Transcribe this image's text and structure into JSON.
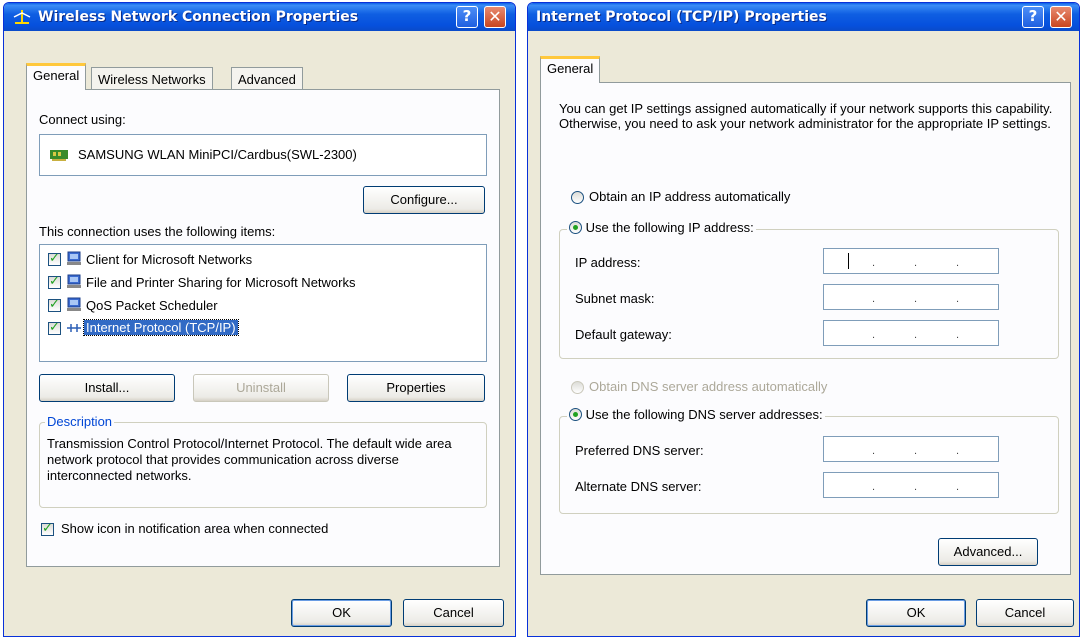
{
  "left_window": {
    "title": "Wireless Network Connection Properties",
    "help_label": "?",
    "close_label": "✕",
    "tabs": [
      {
        "label": "General"
      },
      {
        "label": "Wireless Networks"
      },
      {
        "label": "Advanced"
      }
    ],
    "connect_using_label": "Connect using:",
    "adapter_name": "SAMSUNG WLAN MiniPCI/Cardbus(SWL-2300)",
    "configure_label": "Configure...",
    "items_label": "This connection uses the following items:",
    "items": [
      {
        "label": "Client for Microsoft Networks",
        "checked": true,
        "icon": "network-client-icon"
      },
      {
        "label": "File and Printer Sharing for Microsoft Networks",
        "checked": true,
        "icon": "file-sharing-icon"
      },
      {
        "label": "QoS Packet Scheduler",
        "checked": true,
        "icon": "qos-scheduler-icon"
      },
      {
        "label": "Internet Protocol (TCP/IP)",
        "checked": true,
        "icon": "protocol-icon",
        "selected": true
      }
    ],
    "install_label": "Install...",
    "uninstall_label": "Uninstall",
    "properties_label": "Properties",
    "description_title": "Description",
    "description_text": "Transmission Control Protocol/Internet Protocol. The default wide area network protocol that provides communication across diverse interconnected networks.",
    "show_icon_label": "Show icon in notification area when connected",
    "ok_label": "OK",
    "cancel_label": "Cancel"
  },
  "right_window": {
    "title": "Internet Protocol (TCP/IP) Properties",
    "help_label": "?",
    "close_label": "✕",
    "tab_label": "General",
    "intro_text": "You can get IP settings assigned automatically if your network supports this capability. Otherwise, you need to ask your network administrator for the appropriate IP settings.",
    "obtain_ip_label": "Obtain an IP address automatically",
    "use_ip_label": "Use the following IP address:",
    "ip_address_label": "IP address:",
    "subnet_label": "Subnet mask:",
    "gateway_label": "Default gateway:",
    "obtain_dns_label": "Obtain DNS server address automatically",
    "use_dns_label": "Use the following DNS server addresses:",
    "preferred_dns_label": "Preferred DNS server:",
    "alternate_dns_label": "Alternate DNS server:",
    "advanced_label": "Advanced...",
    "ok_label": "OK",
    "cancel_label": "Cancel",
    "ip_separator": "."
  },
  "colors": {
    "title_bar": "#0a5fe6",
    "dialog_bg": "#ece9d8",
    "selection": "#316ac5",
    "check_green": "#21a121",
    "tab_highlight": "#ffc83c"
  }
}
